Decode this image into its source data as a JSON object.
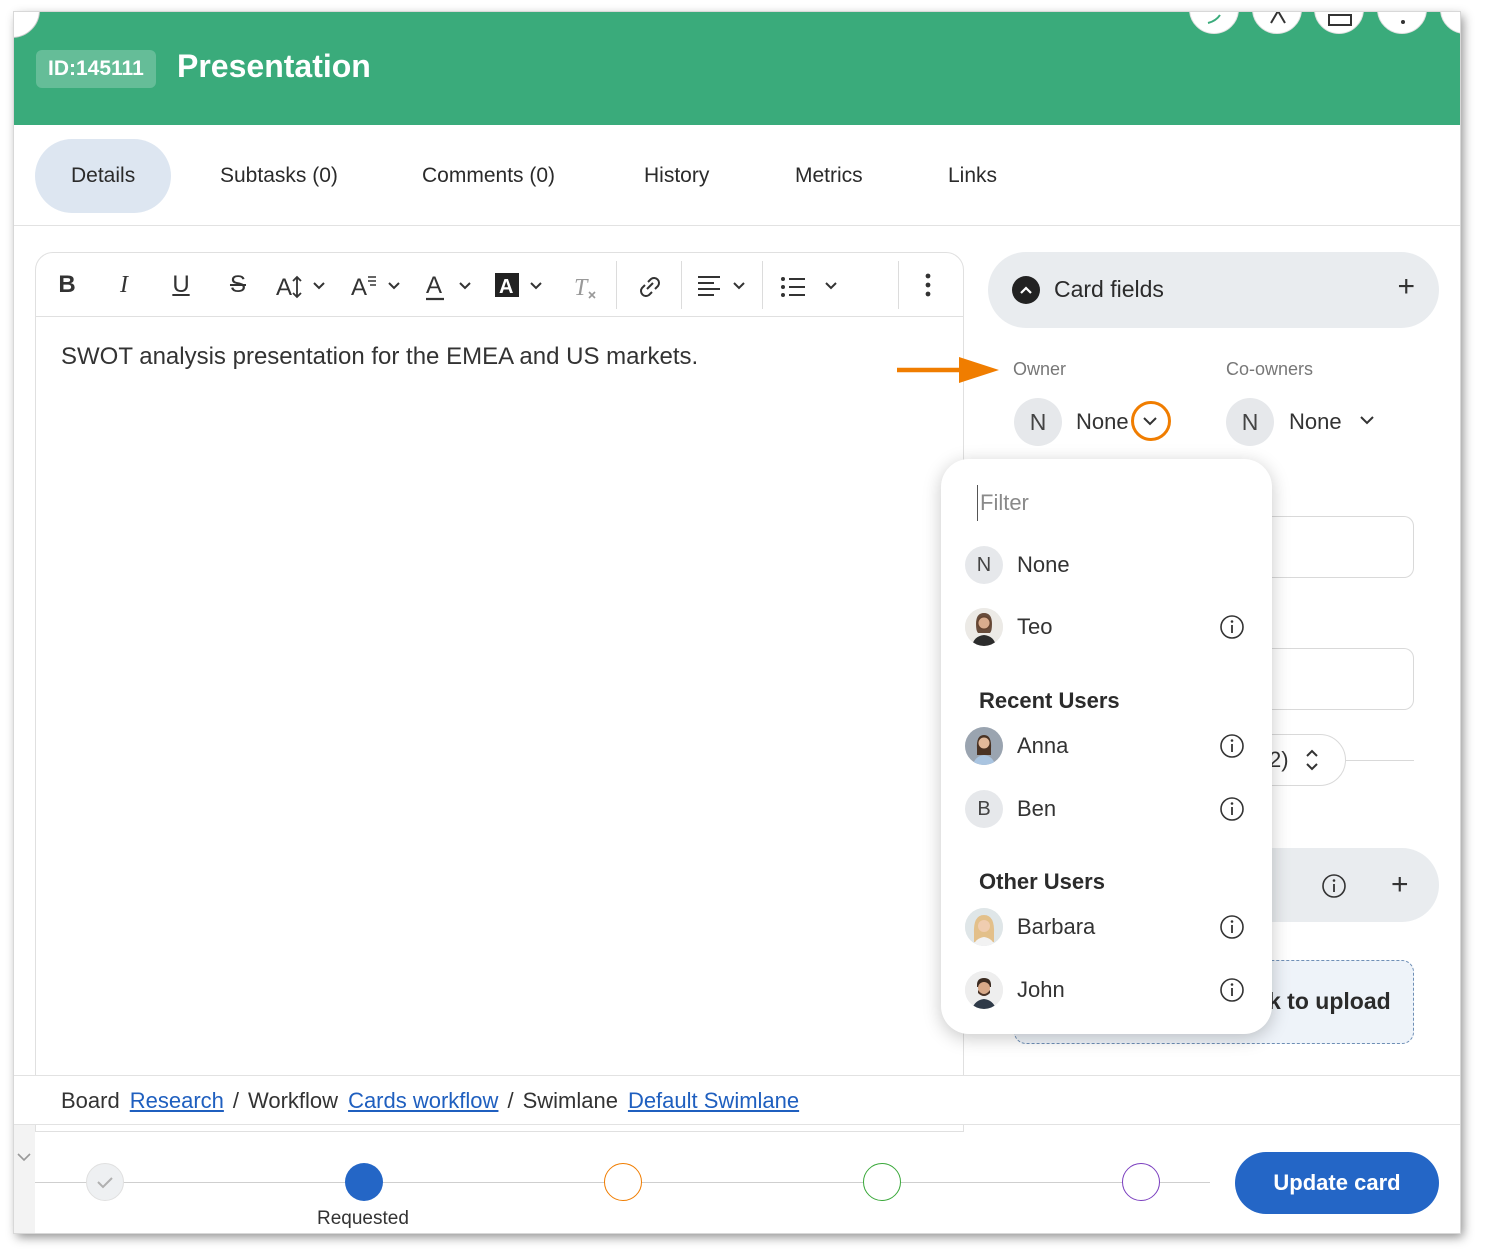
{
  "header": {
    "card_id": "ID:145111",
    "title": "Presentation",
    "color": "#3aab7b"
  },
  "tabs": [
    {
      "label": "Details",
      "active": true
    },
    {
      "label": "Subtasks (0)"
    },
    {
      "label": "Comments (0)"
    },
    {
      "label": "History"
    },
    {
      "label": "Metrics"
    },
    {
      "label": "Links"
    }
  ],
  "editor": {
    "toolbar_icons": [
      "bold-icon",
      "italic-icon",
      "underline-icon",
      "strikethrough-icon",
      "font-size-icon",
      "font-style-icon",
      "font-color-icon",
      "highlight-icon",
      "clear-format-icon",
      "link-icon",
      "align-icon",
      "list-icon",
      "more-icon"
    ],
    "content": "SWOT analysis presentation for the EMEA and US markets."
  },
  "card_fields": {
    "title": "Card fields",
    "owner_label": "Owner",
    "owner_avatar": "N",
    "owner_value": "None",
    "coowners_label": "Co-owners",
    "coowners_avatar": "N",
    "coowners_value": "None",
    "size_partial": "2)",
    "upload_partial": "k to upload"
  },
  "owner_dropdown": {
    "filter_placeholder": "Filter",
    "items": [
      {
        "initial": "N",
        "name": "None"
      },
      {
        "name": "Teo"
      }
    ],
    "recent_heading": "Recent Users",
    "recent": [
      {
        "name": "Anna"
      },
      {
        "initial": "B",
        "name": "Ben"
      }
    ],
    "other_heading": "Other Users",
    "other": [
      {
        "name": "Barbara"
      },
      {
        "name": "John"
      }
    ]
  },
  "breadcrumb": {
    "board_label": "Board",
    "board_link": "Research",
    "workflow_label": "Workflow",
    "workflow_link": "Cards workflow",
    "swimlane_label": "Swimlane",
    "swimlane_link": "Default Swimlane",
    "separator": "/"
  },
  "workflow_steps": {
    "current_label": "Requested",
    "colors": [
      "#b8b8b8",
      "#2466c6",
      "#f07d00",
      "#3aa83a",
      "#7b3fbf"
    ]
  },
  "actions": {
    "update_label": "Update card"
  },
  "colors": {
    "accent": "#2466c6",
    "highlight": "#f07d00"
  }
}
